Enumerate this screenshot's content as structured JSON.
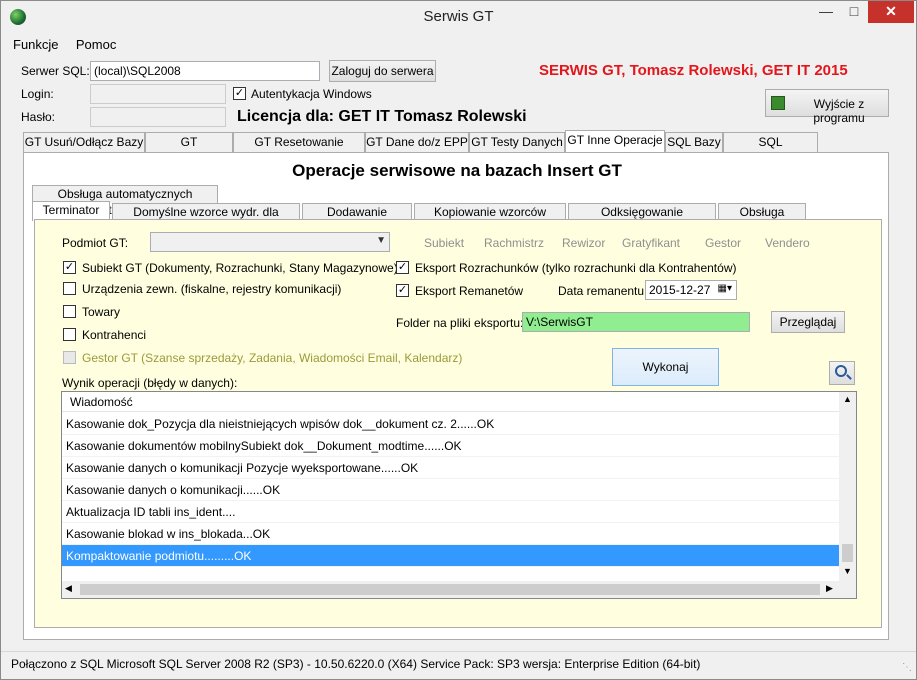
{
  "window": {
    "title": "Serwis GT"
  },
  "menu": {
    "items": [
      "Funkcje",
      "Pomoc"
    ]
  },
  "server": {
    "label": "Serwer SQL:",
    "value": "(local)\\SQL2008",
    "login_button": "Zaloguj do serwera",
    "login_label": "Login:",
    "password_label": "Hasło:",
    "windows_auth_label": "Autentykacja Windows",
    "windows_auth_checked": true
  },
  "brand_text": "SERWIS GT, Tomasz Rolewski, GET IT 2015",
  "licence_text": "Licencja dla: GET IT Tomasz Rolewski",
  "exit_button": "Wyjście z programu",
  "main_tabs": [
    {
      "label": "GT Usuń/Odłącz Bazy"
    },
    {
      "label": "GT Użytkownicy"
    },
    {
      "label": "GT Resetowanie Licencji"
    },
    {
      "label": "GT Dane do/z EPP"
    },
    {
      "label": "GT Testy Danych"
    },
    {
      "label": "GT Inne Operacje"
    },
    {
      "label": "SQL Bazy"
    },
    {
      "label": "SQL Użytkownicy"
    }
  ],
  "active_main_tab": "GT Inne Operacje",
  "panel_title": "Operacje serwisowe na bazach Insert GT",
  "inner_tabs_row1": [
    {
      "label": "Obsługa automatycznych aktualizacji"
    }
  ],
  "inner_tabs_row2": [
    {
      "label": "Terminator GT"
    },
    {
      "label": "Domyślne wzorce wydr. dla stanowisk"
    },
    {
      "label": "Dodawanie skryptów"
    },
    {
      "label": "Kopiowanie wzorców wydruku"
    },
    {
      "label": "Odksięgowanie dokumentów"
    },
    {
      "label": "Obsługa InsMail"
    }
  ],
  "active_inner_tab": "Terminator GT",
  "podmiot": {
    "label": "Podmiot GT:",
    "value": "",
    "modules": [
      "Subiekt",
      "Rachmistrz",
      "Rewizor",
      "Gratyfikant",
      "Gestor",
      "Vendero"
    ]
  },
  "left_checks": [
    {
      "label": "Subiekt GT (Dokumenty, Rozrachunki, Stany Magazynowe)",
      "checked": true,
      "disabled": false
    },
    {
      "label": "Urządzenia zewn. (fiskalne, rejestry komunikacji)",
      "checked": false,
      "disabled": false
    },
    {
      "label": "Towary",
      "checked": false,
      "disabled": false
    },
    {
      "label": "Kontrahenci",
      "checked": false,
      "disabled": false
    },
    {
      "label": "Gestor GT (Szanse sprzedaży, Zadania, Wiadomości Email, Kalendarz)",
      "checked": false,
      "disabled": true
    }
  ],
  "right_checks": [
    {
      "label": "Eksport Rozrachunków (tylko rozrachunki dla Kontrahentów)",
      "checked": true
    },
    {
      "label": "Eksport Remanetów",
      "checked": true
    }
  ],
  "data_remanentu": {
    "label": "Data remanentu:",
    "value": "2015-12-27"
  },
  "folder": {
    "label": "Folder na pliki eksportu:",
    "value": "V:\\SerwisGT",
    "browse_button": "Przeglądaj"
  },
  "execute_button": "Wykonaj",
  "result_label": "Wynik operacji (błędy w danych):",
  "results": {
    "header": "Wiadomość",
    "rows": [
      "Kasowanie dok_Pozycja dla nieistniejących wpisów dok__dokument cz. 2......OK",
      "Kasowanie dokumentów mobilnySubiekt dok__Dokument_modtime......OK",
      "Kasowanie danych o komunikacji Pozycje wyeksportowane......OK",
      "Kasowanie danych o komunikacji......OK",
      "Aktualizacja ID tabli ins_ident....",
      "Kasowanie blokad w ins_blokada...OK",
      "Kompaktowanie podmiotu.........OK"
    ],
    "selected_index": 6
  },
  "statusbar": {
    "text": "Połączono z SQL  Microsoft SQL Server 2008 R2 (SP3) - 10.50.6220.0 (X64)  Service Pack: SP3  wersja: Enterprise Edition (64-bit)"
  },
  "colors": {
    "brand": "#e3161c",
    "inner_panel_bg": "#ffffe0",
    "folder_bg": "#90ee90",
    "selected_row": "#3399ff"
  }
}
